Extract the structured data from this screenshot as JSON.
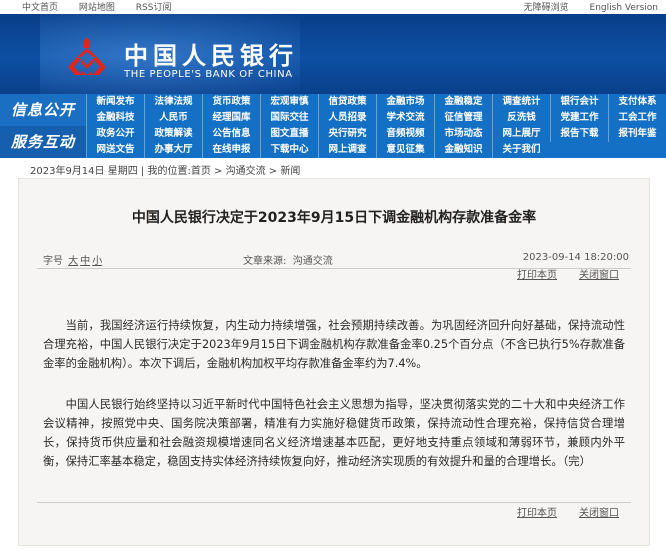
{
  "topbar": {
    "left_items": [
      "中文首页",
      "网站地图",
      "RSS订阅"
    ],
    "right_items": [
      "无障碍浏览",
      "English Version"
    ]
  },
  "header": {
    "brand_cn": "中国人民银行",
    "brand_en": "THE PEOPLE'S BANK OF CHINA"
  },
  "nav": {
    "category_1": "信息公开",
    "category_2": "服务互动",
    "rows": [
      [
        "新闻发布",
        "法律法规",
        "货币政策",
        "宏观审慎",
        "信贷政策",
        "金融市场",
        "金融稳定",
        "调查统计",
        "银行会计",
        "支付体系"
      ],
      [
        "金融科技",
        "人民币",
        "经理国库",
        "国际交往",
        "人员招录",
        "学术交流",
        "征信管理",
        "反洗钱",
        "党建工作",
        "工会工作"
      ],
      [
        "政务公开",
        "政策解读",
        "公告信息",
        "图文直播",
        "央行研究",
        "音频视频",
        "市场动态",
        "网上展厅",
        "报告下载",
        "报刊年鉴"
      ],
      [
        "网送文告",
        "办事大厅",
        "在线申报",
        "下载中心",
        "网上调查",
        "意见征集",
        "金融知识",
        "关于我们"
      ]
    ]
  },
  "breadcrumb": {
    "date": "2023年9月14日 星期四",
    "prefix": " | 我的位置:",
    "home": "首页",
    "sep": " > ",
    "section": "沟通交流",
    "current": "新闻"
  },
  "article": {
    "title": "中国人民银行决定于2023年9月15日下调金融机构存款准备金率",
    "font_size_label": "字号",
    "font_sizes": [
      "大",
      "中",
      "小"
    ],
    "source_label": "文章来源:",
    "source": "沟通交流",
    "datetime": "2023-09-14 18:20:00",
    "print_label": "打印本页",
    "close_label": "关闭窗口",
    "paragraphs": [
      "当前，我国经济运行持续恢复，内生动力持续增强，社会预期持续改善。为巩固经济回升向好基础，保持流动性合理充裕，中国人民银行决定于2023年9月15日下调金融机构存款准备金率0.25个百分点（不含已执行5%存款准备金率的金融机构）。本次下调后，金融机构加权平均存款准备金率约为7.4%。",
      "中国人民银行始终坚持以习近平新时代中国特色社会主义思想为指导，坚决贯彻落实党的二十大和中央经济工作会议精神，按照党中央、国务院决策部署，精准有力实施好稳健货币政策，保持流动性合理充裕，保持信贷合理增长，保持货币供应量和社会融资规模增速同名义经济增速基本匹配，更好地支持重点领域和薄弱环节，兼顾内外平衡，保持汇率基本稳定，稳固支持实体经济持续恢复向好，推动经济实现质的有效提升和量的合理增长。（完）"
    ]
  },
  "colors": {
    "banner": "#0d4fa3",
    "nav": "#1470c4",
    "logo": "#e0261b"
  },
  "icons": {
    "logo": "pboc-emblem-icon"
  }
}
